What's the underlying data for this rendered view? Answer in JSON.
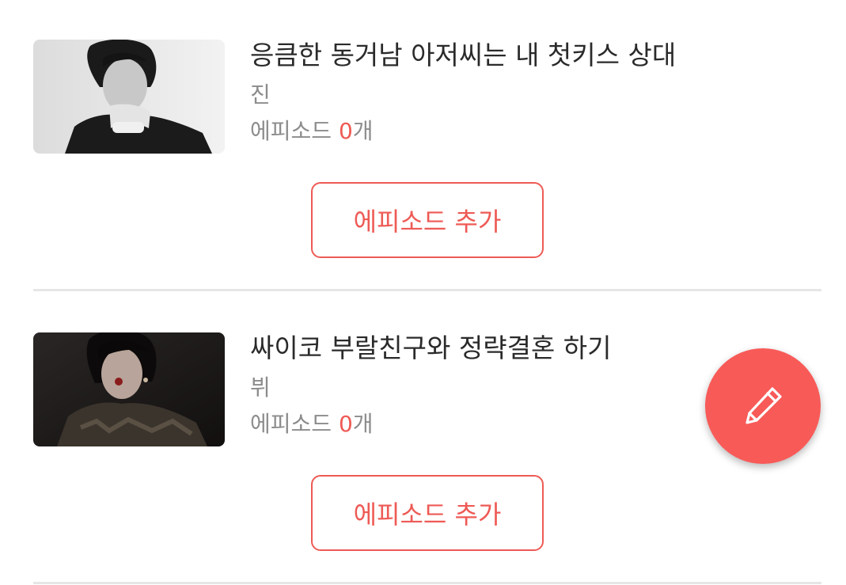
{
  "stories": [
    {
      "title": "응큼한 동거남 아저씨는 내 첫키스 상대",
      "author": "진",
      "episodes_label": "에피소드",
      "episodes_count": "0",
      "episodes_unit": "개",
      "add_episode_label": "에피소드 추가",
      "thumbnail": "black-and-white-portrait-photo"
    },
    {
      "title": "싸이코 부랄친구와 정략결혼 하기",
      "author": "뷔",
      "episodes_label": "에피소드",
      "episodes_count": "0",
      "episodes_unit": "개",
      "add_episode_label": "에피소드 추가",
      "thumbnail": "dark-color-portrait-photo"
    }
  ],
  "fab": {
    "icon": "pencil-icon"
  },
  "colors": {
    "accent": "#ee5a55",
    "fab": "#f85a58",
    "title": "#2a2a2a",
    "muted": "#8c8c8c",
    "divider": "#e6e6e6"
  }
}
